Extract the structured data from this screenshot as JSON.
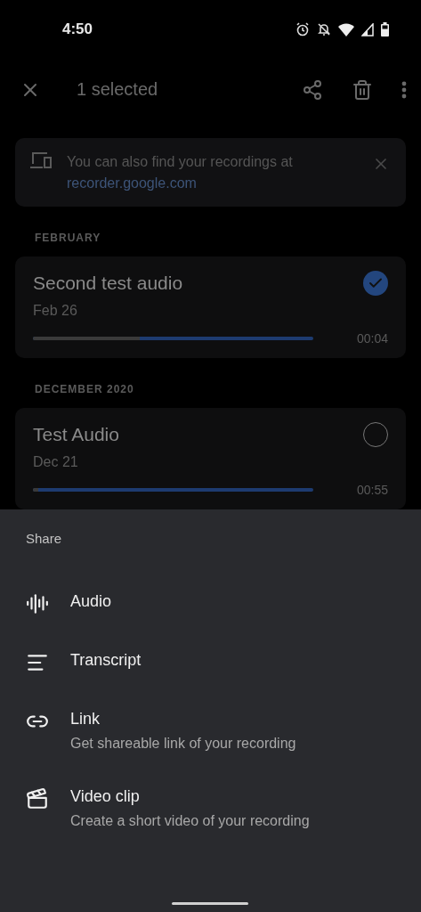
{
  "status_bar": {
    "time": "4:50"
  },
  "app_bar": {
    "title": "1 selected"
  },
  "banner": {
    "text": "You can also find your recordings at",
    "link": "recorder.google.com"
  },
  "sections": [
    {
      "header": "FEBRUARY",
      "recordings": [
        {
          "title": "Second test audio",
          "date": "Feb 26",
          "level": 0.38,
          "duration": "00:04",
          "selected": true
        }
      ]
    },
    {
      "header": "DECEMBER 2020",
      "recordings": [
        {
          "title": "Test Audio",
          "date": "Dec 21",
          "level": 0.02,
          "duration": "00:55",
          "selected": false
        }
      ]
    }
  ],
  "share_sheet": {
    "title": "Share",
    "options": [
      {
        "kind": "audio",
        "label": "Audio"
      },
      {
        "kind": "transcript",
        "label": "Transcript"
      },
      {
        "kind": "link",
        "label": "Link",
        "description": "Get shareable link of your recording"
      },
      {
        "kind": "video",
        "label": "Video clip",
        "description": "Create a short video of your recording"
      }
    ]
  }
}
